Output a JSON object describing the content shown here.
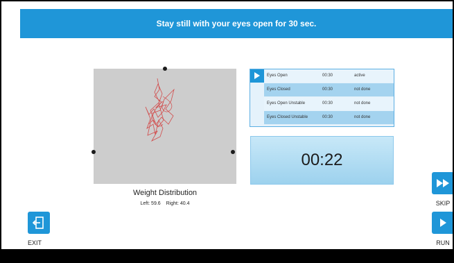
{
  "banner": {
    "text": "Stay still with your eyes open for 30 sec."
  },
  "weight": {
    "title": "Weight Distribution",
    "left_label": "Left: 59.6",
    "right_label": "Right: 40.4"
  },
  "tests": [
    {
      "name": "Eyes Open",
      "time": "00:30",
      "status": "active"
    },
    {
      "name": "Eyes Closed",
      "time": "00:30",
      "status": "not done"
    },
    {
      "name": "Eyes Open Unstable",
      "time": "00:30",
      "status": "not done"
    },
    {
      "name": "Eyes Closed Unstable",
      "time": "00:30",
      "status": "not done"
    }
  ],
  "timer": {
    "value": "00:22"
  },
  "buttons": {
    "skip": "SKIP",
    "run": "RUN",
    "exit": "EXIT"
  },
  "colors": {
    "accent": "#1f96d8",
    "trace": "#d24b4b",
    "plot_bg": "#cdcdcd"
  },
  "icons": {
    "play": "play-icon",
    "skip": "fast-forward-icon",
    "exit": "exit-door-icon"
  }
}
